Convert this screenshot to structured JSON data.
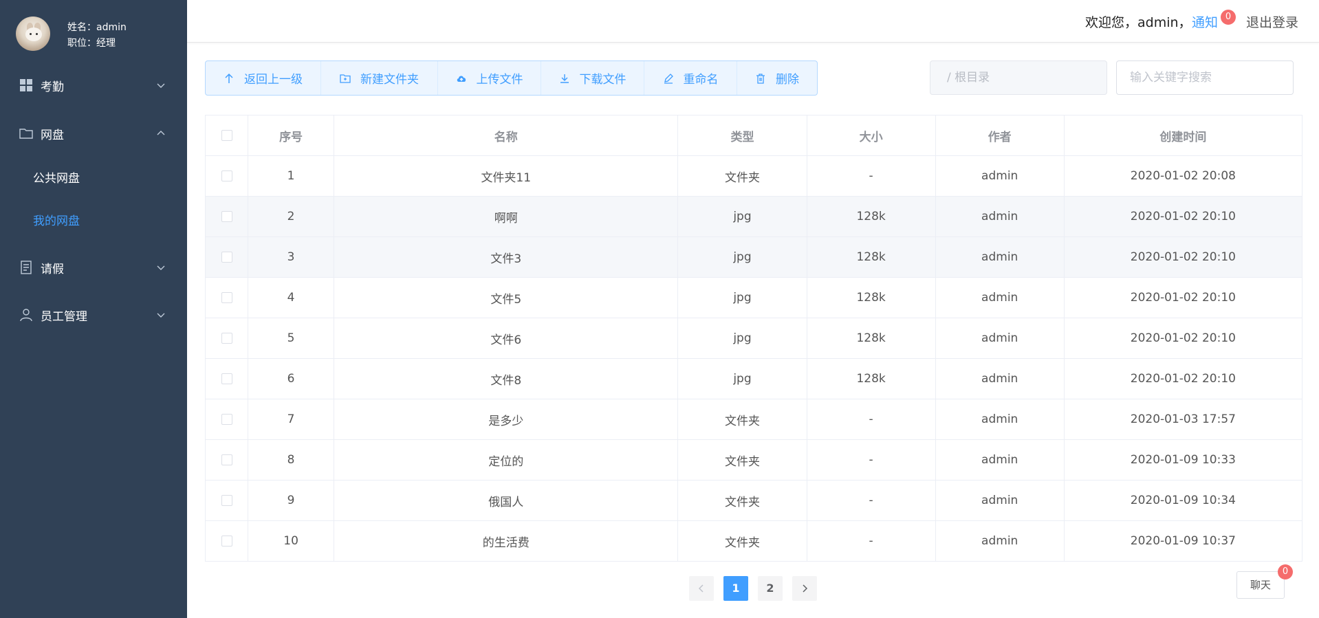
{
  "user": {
    "name_line": "姓名：admin",
    "role_line": "职位：经理"
  },
  "sidebar": {
    "items": [
      {
        "label": "考勤",
        "icon": "grid-icon"
      },
      {
        "label": "网盘",
        "icon": "folder-icon"
      },
      {
        "label": "请假",
        "icon": "document-icon"
      },
      {
        "label": "员工管理",
        "icon": "person-icon"
      }
    ],
    "disk_sub": [
      {
        "label": "公共网盘",
        "active": false
      },
      {
        "label": "我的网盘",
        "active": true
      }
    ]
  },
  "header": {
    "welcome": "欢迎您，admin，",
    "notice": "通知",
    "notice_count": "0",
    "logout": "退出登录"
  },
  "toolbar": {
    "buttons": [
      {
        "label": "返回上一级",
        "icon": "arrow-up-icon"
      },
      {
        "label": "新建文件夹",
        "icon": "folder-add-icon"
      },
      {
        "label": "上传文件",
        "icon": "cloud-upload-icon"
      },
      {
        "label": "下载文件",
        "icon": "download-icon"
      },
      {
        "label": "重命名",
        "icon": "edit-icon"
      },
      {
        "label": "删除",
        "icon": "trash-icon"
      }
    ]
  },
  "path": {
    "value": "/ 根目录"
  },
  "search": {
    "placeholder": "输入关键字搜索"
  },
  "table": {
    "headers": [
      "序号",
      "名称",
      "类型",
      "大小",
      "作者",
      "创建时间"
    ],
    "rows": [
      [
        "1",
        "文件夹11",
        "文件夹",
        "-",
        "admin",
        "2020-01-02 20:08"
      ],
      [
        "2",
        "啊啊",
        "jpg",
        "128k",
        "admin",
        "2020-01-02 20:10"
      ],
      [
        "3",
        "文件3",
        "jpg",
        "128k",
        "admin",
        "2020-01-02 20:10"
      ],
      [
        "4",
        "文件5",
        "jpg",
        "128k",
        "admin",
        "2020-01-02 20:10"
      ],
      [
        "5",
        "文件6",
        "jpg",
        "128k",
        "admin",
        "2020-01-02 20:10"
      ],
      [
        "6",
        "文件8",
        "jpg",
        "128k",
        "admin",
        "2020-01-02 20:10"
      ],
      [
        "7",
        "是多少",
        "文件夹",
        "-",
        "admin",
        "2020-01-03 17:57"
      ],
      [
        "8",
        "定位的",
        "文件夹",
        "-",
        "admin",
        "2020-01-09 10:33"
      ],
      [
        "9",
        "俄国人",
        "文件夹",
        "-",
        "admin",
        "2020-01-09 10:34"
      ],
      [
        "10",
        "的生活费",
        "文件夹",
        "-",
        "admin",
        "2020-01-09 10:37"
      ]
    ]
  },
  "pagination": {
    "pages": [
      "1",
      "2"
    ],
    "current": "1"
  },
  "chat": {
    "label": "聊天",
    "count": "0"
  },
  "colors": {
    "sidebar_bg": "#304156",
    "accent": "#409eff",
    "badge": "#f56c6c"
  }
}
